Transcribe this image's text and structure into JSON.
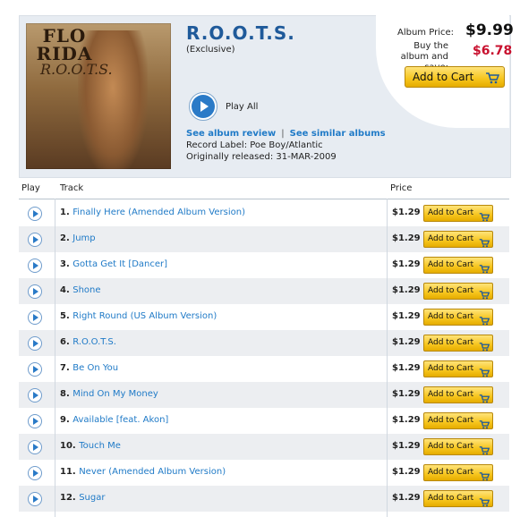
{
  "album": {
    "title": "R.O.O.T.S.",
    "subtitle": "(Exclusive)",
    "play_all_label": "Play All",
    "review_link": "See album review",
    "separator": "|",
    "similar_link": "See similar albums",
    "record_label": "Record Label: Poe Boy/Atlantic",
    "released": "Originally released: 31-MAR-2009"
  },
  "cover": {
    "logo_text": "FLO RIDA",
    "sub_text": "R.O.O.T.S."
  },
  "pricing": {
    "album_price_label": "Album Price:",
    "album_price": "$9.99",
    "save_label": "Buy the album and save:",
    "save_price": "$6.78",
    "add_to_cart_label": "Add to Cart"
  },
  "columns": {
    "play": "Play",
    "track": "Track",
    "price": "Price"
  },
  "tracks": [
    {
      "num": "1.",
      "title": "Finally Here (Amended Album Version)",
      "price": "$1.29",
      "cart": "Add to Cart"
    },
    {
      "num": "2.",
      "title": "Jump",
      "price": "$1.29",
      "cart": "Add to Cart"
    },
    {
      "num": "3.",
      "title": "Gotta Get It [Dancer]",
      "price": "$1.29",
      "cart": "Add to Cart"
    },
    {
      "num": "4.",
      "title": "Shone",
      "price": "$1.29",
      "cart": "Add to Cart"
    },
    {
      "num": "5.",
      "title": "Right Round (US Album Version)",
      "price": "$1.29",
      "cart": "Add to Cart"
    },
    {
      "num": "6.",
      "title": "R.O.O.T.S.",
      "price": "$1.29",
      "cart": "Add to Cart"
    },
    {
      "num": "7.",
      "title": "Be On You",
      "price": "$1.29",
      "cart": "Add to Cart"
    },
    {
      "num": "8.",
      "title": "Mind On My Money",
      "price": "$1.29",
      "cart": "Add to Cart"
    },
    {
      "num": "9.",
      "title": "Available [feat. Akon]",
      "price": "$1.29",
      "cart": "Add to Cart"
    },
    {
      "num": "10.",
      "title": "Touch Me",
      "price": "$1.29",
      "cart": "Add to Cart"
    },
    {
      "num": "11.",
      "title": "Never (Amended Album Version)",
      "price": "$1.29",
      "cart": "Add to Cart"
    },
    {
      "num": "12.",
      "title": "Sugar",
      "price": "$1.29",
      "cart": "Add to Cart"
    }
  ],
  "colors": {
    "accent_blue": "#1f7ac7",
    "title_blue": "#1f5a9a",
    "save_red": "#c8102e",
    "cart_yellow": "#f6c51d",
    "row_alt": "#eceef1",
    "header_bg": "#e7ecf2"
  },
  "icons": {
    "play": "play-circle-icon",
    "cart": "shopping-cart-icon"
  }
}
